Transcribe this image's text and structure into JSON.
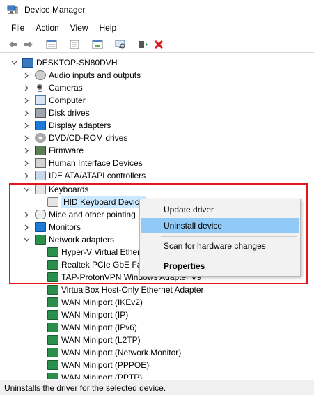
{
  "window": {
    "title": "Device Manager"
  },
  "menu": [
    "File",
    "Action",
    "View",
    "Help"
  ],
  "toolbar": {
    "buttons": [
      "back-arrow-icon",
      "forward-arrow-icon",
      "properties-icon",
      "help-icon",
      "update-driver-icon",
      "scan-hardware-icon",
      "add-device-icon",
      "uninstall-x-icon"
    ],
    "colors": {
      "uninstall": "#e0161d",
      "add": "#1c8b3a"
    }
  },
  "tree": {
    "root": "DESKTOP-SN80DVH",
    "categories": [
      "Audio inputs and outputs",
      "Cameras",
      "Computer",
      "Disk drives",
      "Display adapters",
      "DVD/CD-ROM drives",
      "Firmware",
      "Human Interface Devices",
      "IDE ATA/ATAPI controllers",
      "Keyboards",
      "Mice and other pointing devices",
      "Monitors",
      "Network adapters"
    ],
    "keyboard_children": [
      "HID Keyboard Device"
    ],
    "network_children": [
      "Hyper-V Virtual Ethernet Adapter",
      "Realtek PCIe GbE Family Controller",
      "TAP-ProtonVPN Windows Adapter V9",
      "VirtualBox Host-Only Ethernet Adapter",
      "WAN Miniport (IKEv2)",
      "WAN Miniport (IP)",
      "WAN Miniport (IPv6)",
      "WAN Miniport (L2TP)",
      "WAN Miniport (Network Monitor)",
      "WAN Miniport (PPPOE)",
      "WAN Miniport (PPTP)"
    ]
  },
  "visible_labels": {
    "mice": "Mice and other pointing",
    "hyperv": "Hyper-V Virtual Ether",
    "realtek": "Realtek PCIe GbE Fan",
    "tap": "TAP-ProtonVPN Windows Adapter V9"
  },
  "context_menu": {
    "items": [
      "Update driver",
      "Uninstall device",
      "Scan for hardware changes",
      "Properties"
    ],
    "highlighted": "Uninstall device",
    "highlight_color": "#91c9f7"
  },
  "status": {
    "text": "Uninstalls the driver for the selected device."
  },
  "accent": {
    "red_outline": "#e0161d",
    "selection": "#cce8ff"
  }
}
